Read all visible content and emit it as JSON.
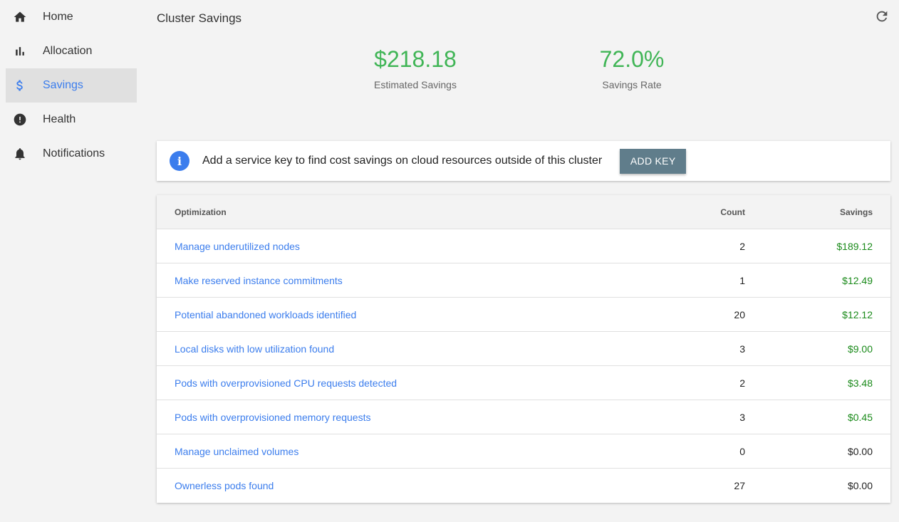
{
  "sidebar": {
    "items": [
      {
        "label": "Home",
        "icon": "home-icon"
      },
      {
        "label": "Allocation",
        "icon": "bar-chart-icon"
      },
      {
        "label": "Savings",
        "icon": "dollar-icon",
        "active": true
      },
      {
        "label": "Health",
        "icon": "alert-circle-icon"
      },
      {
        "label": "Notifications",
        "icon": "bell-icon"
      }
    ]
  },
  "header": {
    "title": "Cluster Savings",
    "refresh_icon": "refresh-icon"
  },
  "metrics": {
    "estimated_savings": {
      "value": "$218.18",
      "label": "Estimated Savings"
    },
    "savings_rate": {
      "value": "72.0%",
      "label": "Savings Rate"
    }
  },
  "banner": {
    "icon": "info-icon",
    "text": "Add a service key to find cost savings on cloud resources outside of this cluster",
    "button_label": "ADD KEY"
  },
  "table": {
    "columns": [
      "Optimization",
      "Count",
      "Savings"
    ],
    "rows": [
      {
        "name": "Manage underutilized nodes",
        "count": "2",
        "savings": "$189.12"
      },
      {
        "name": "Make reserved instance commitments",
        "count": "1",
        "savings": "$12.49"
      },
      {
        "name": "Potential abandoned workloads identified",
        "count": "20",
        "savings": "$12.12"
      },
      {
        "name": "Local disks with low utilization found",
        "count": "3",
        "savings": "$9.00"
      },
      {
        "name": "Pods with overprovisioned CPU requests detected",
        "count": "2",
        "savings": "$3.48"
      },
      {
        "name": "Pods with overprovisioned memory requests",
        "count": "3",
        "savings": "$0.45"
      },
      {
        "name": "Manage unclaimed volumes",
        "count": "0",
        "savings": "$0.00"
      },
      {
        "name": "Ownerless pods found",
        "count": "27",
        "savings": "$0.00"
      }
    ]
  },
  "colors": {
    "accent": "#3b7ded",
    "metric_green": "#40b556",
    "savings_green": "#1a8a1a",
    "button": "#607d8b"
  }
}
